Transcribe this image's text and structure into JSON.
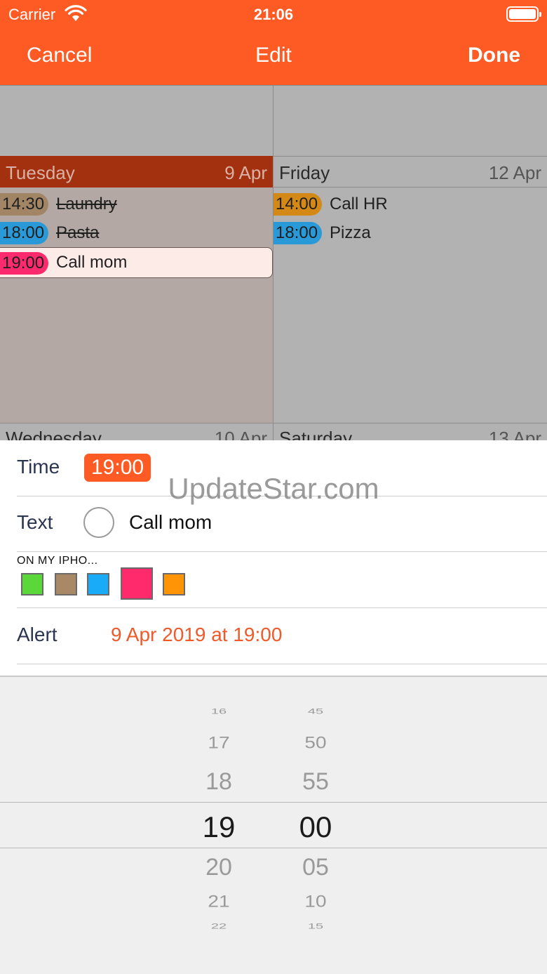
{
  "status_bar": {
    "carrier": "Carrier",
    "time": "21:06"
  },
  "nav": {
    "cancel": "Cancel",
    "title": "Edit",
    "done": "Done"
  },
  "calendar": {
    "days": [
      {
        "name": "Tuesday",
        "date": "9 Apr",
        "events": [
          {
            "time": "14:30",
            "text": "Laundry",
            "done": true,
            "color": "#a18565"
          },
          {
            "time": "18:00",
            "text": "Pasta",
            "done": true,
            "color": "#2a99d8"
          },
          {
            "time": "19:00",
            "text": "Call mom",
            "done": false,
            "color": "#fd2b6e"
          }
        ]
      },
      {
        "name": "Friday",
        "date": "12 Apr",
        "events": [
          {
            "time": "14:00",
            "text": "Call HR",
            "done": false,
            "color": "#d48917"
          },
          {
            "time": "18:00",
            "text": "Pizza",
            "done": false,
            "color": "#2a99d8"
          }
        ]
      }
    ],
    "next_days": [
      {
        "name": "Wednesday",
        "date": "10 Apr"
      },
      {
        "name": "Saturday",
        "date": "13 Apr"
      }
    ]
  },
  "form": {
    "time_label": "Time",
    "time_value": "19:00",
    "text_label": "Text",
    "text_value": "Call mom",
    "calendar_label": "ON MY IPHO...",
    "colors": [
      "#5ad83a",
      "#a88865",
      "#1aabf8",
      "#fe2a6c",
      "#ff9506"
    ],
    "selected_color_index": 3,
    "alert_label": "Alert",
    "alert_value": "9 Apr 2019 at 19:00"
  },
  "watermark": "UpdateStar.com",
  "picker": {
    "hours": [
      "16",
      "17",
      "18",
      "19",
      "20",
      "21",
      "22"
    ],
    "minutes": [
      "45",
      "50",
      "55",
      "00",
      "05",
      "10",
      "15"
    ],
    "selected_hour": "19",
    "selected_minute": "00"
  },
  "accent_color": "#fd5a24"
}
